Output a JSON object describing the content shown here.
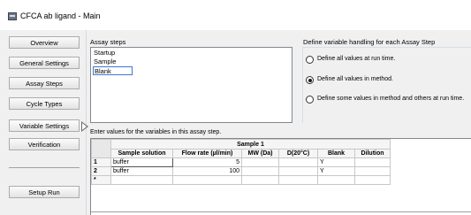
{
  "window": {
    "title": "CFCA ab ligand - Main"
  },
  "sidebar": {
    "items": [
      {
        "label": "Overview"
      },
      {
        "label": "General Settings"
      },
      {
        "label": "Assay Steps"
      },
      {
        "label": "Cycle Types"
      },
      {
        "label": "Variable Settings",
        "active": true
      },
      {
        "label": "Verification"
      }
    ],
    "setup_run": "Setup Run"
  },
  "assay_steps": {
    "label": "Assay steps",
    "items": [
      "Startup",
      "Sample",
      "Blank"
    ],
    "selected": "Blank"
  },
  "variable_handling": {
    "label": "Define variable handling for each Assay Step",
    "options": [
      {
        "label": "Define all values at run time.",
        "checked": false
      },
      {
        "label": "Define all values in method.",
        "checked": true
      },
      {
        "label": "Define some values in method and others at run time.",
        "checked": false
      }
    ]
  },
  "grid": {
    "instruction": "Enter values for the variables in this assay step.",
    "group_header": "Sample 1",
    "columns": [
      "Sample solution",
      "Flow rate (µl/min)",
      "MW (Da)",
      "D(20°C)",
      "Blank",
      "Dilution"
    ],
    "rows": [
      {
        "head": "1",
        "cells": [
          "buffer",
          "5",
          "",
          "",
          "Y",
          ""
        ]
      },
      {
        "head": "2",
        "cells": [
          "buffer",
          "100",
          "",
          "",
          "Y",
          ""
        ]
      },
      {
        "head": "*",
        "cells": [
          "",
          "",
          "",
          "",
          "",
          ""
        ]
      }
    ]
  }
}
